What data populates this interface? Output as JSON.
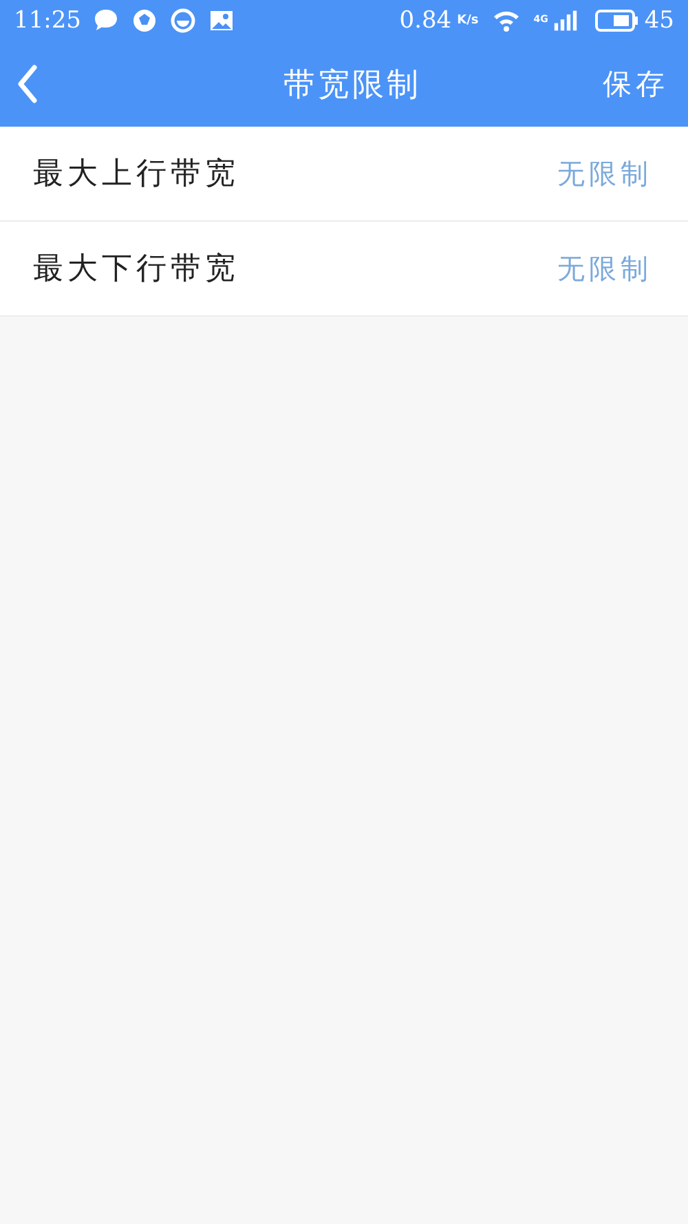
{
  "status_bar": {
    "time": "11:25",
    "speed": "0.84",
    "speed_unit": "K/s",
    "network": "4G",
    "battery": "45"
  },
  "header": {
    "title": "带宽限制",
    "action": "保存"
  },
  "rows": [
    {
      "label": "最大上行带宽",
      "value": "无限制"
    },
    {
      "label": "最大下行带宽",
      "value": "无限制"
    }
  ]
}
